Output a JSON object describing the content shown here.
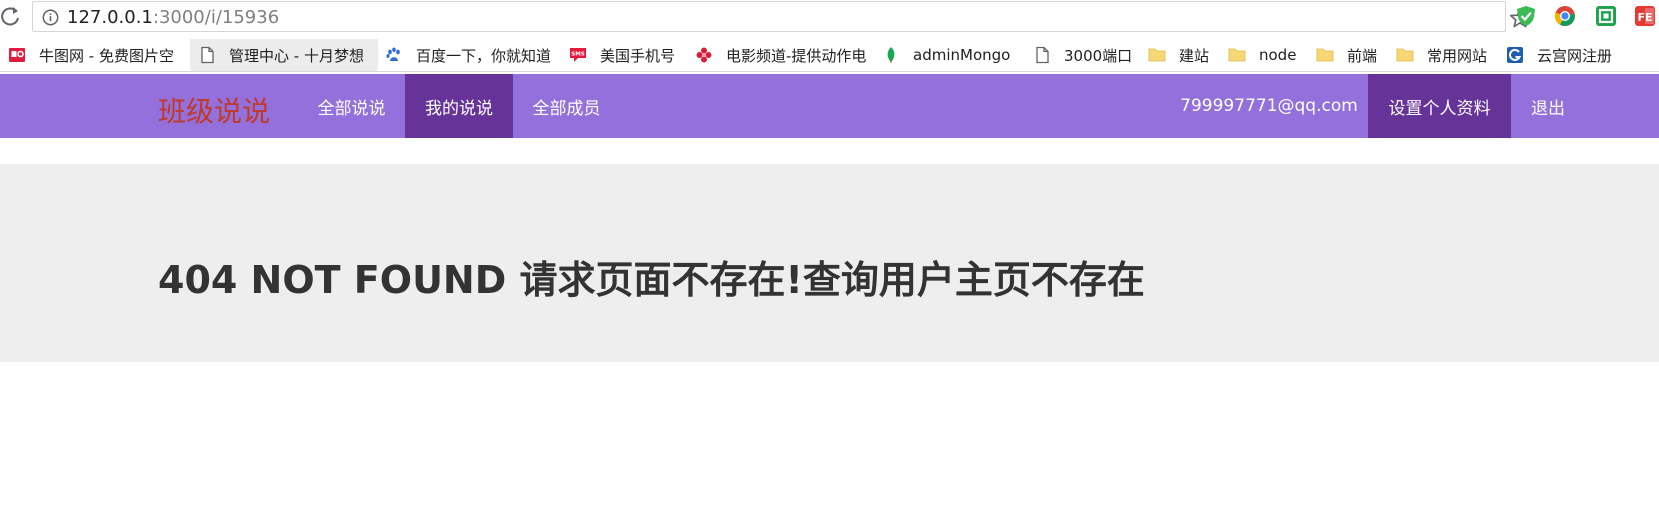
{
  "browser": {
    "url_host": "127.0.0.1",
    "url_path": ":3000/i/15936",
    "extensions": [
      "shield-extension",
      "chrome-extension",
      "green-square-extension",
      "fe-extension"
    ]
  },
  "bookmarks": [
    {
      "label": "牛图网 - 免费图片空",
      "icon": "photo-icon"
    },
    {
      "label": "管理中心 - 十月梦想",
      "icon": "page-icon"
    },
    {
      "label": "百度一下，你就知道",
      "icon": "baidu-paw-icon"
    },
    {
      "label": "美国手机号",
      "icon": "sms-icon"
    },
    {
      "label": "电影频道-提供动作电",
      "icon": "movie-flower-icon"
    },
    {
      "label": "adminMongo",
      "icon": "mongo-leaf-icon"
    },
    {
      "label": "3000端口",
      "icon": "page-icon"
    },
    {
      "label": "建站",
      "icon": "folder-icon"
    },
    {
      "label": "node",
      "icon": "folder-icon"
    },
    {
      "label": "前端",
      "icon": "folder-icon"
    },
    {
      "label": "常用网站",
      "icon": "folder-icon"
    },
    {
      "label": "云宫网注册",
      "icon": "yg-logo-icon"
    }
  ],
  "navbar": {
    "brand": "班级说说",
    "items": [
      {
        "label": "全部说说",
        "active": false
      },
      {
        "label": "我的说说",
        "active": true
      },
      {
        "label": "全部成员",
        "active": false
      }
    ],
    "user_email": "799997771@qq.com",
    "settings_label": "设置个人资料",
    "logout_label": "退出"
  },
  "main": {
    "message": "404 NOT FOUND 请求页面不存在!查询用户主页不存在"
  },
  "colors": {
    "navbar_bg": "#9370db",
    "navbar_active_bg": "#663399",
    "brand": "#c0392b",
    "jumbotron_bg": "#eeeeee",
    "message_text": "#333333"
  }
}
